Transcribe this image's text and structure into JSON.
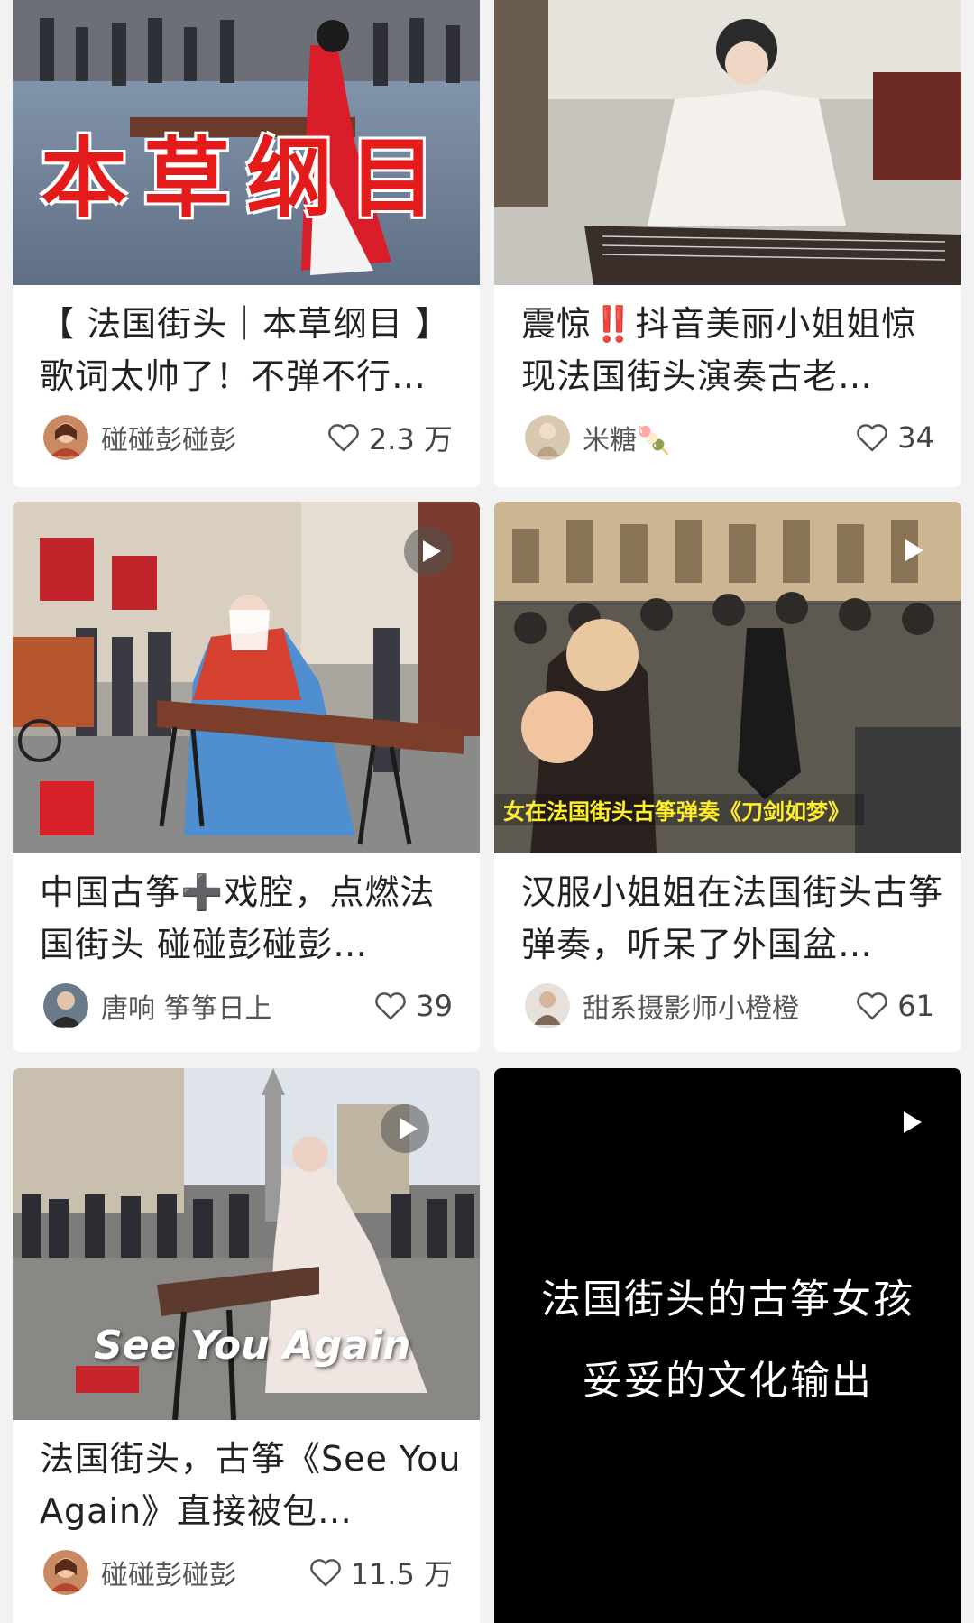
{
  "cards": [
    {
      "title": "【 法国街头｜本草纲目 】歌词太帅了！不弹不行…",
      "overlay_text": "本草纲目",
      "author": "碰碰彭碰彭",
      "likes": "2.3 万",
      "has_play": false
    },
    {
      "title_prefix": "震惊",
      "title_emoji": "‼️",
      "title_suffix": "抖音美丽小姐姐惊现法国街头演奏古老…",
      "author": "米糖🍡",
      "likes": "34",
      "has_play": false
    },
    {
      "title_prefix": "中国古筝",
      "title_emoji": "➕",
      "title_suffix": "戏腔，点燃法国街头 碰碰彭碰彭…",
      "author": "唐响 筝筝日上",
      "likes": "39",
      "has_play": true
    },
    {
      "title": "汉服小姐姐在法国街头古筝弹奏，听呆了外国盆…",
      "overlay_text": "女在法国街头古筝弹奏《刀剑如梦》",
      "author": "甜系摄影师小橙橙",
      "likes": "61",
      "has_play": true
    },
    {
      "title": "法国街头，古筝《See You Again》直接被包…",
      "overlay_text": "See You Again",
      "author": "碰碰彭碰彭",
      "likes": "11.5 万",
      "has_play": true
    },
    {
      "line1": "法国街头的古筝女孩",
      "line2": "妥妥的文化输出",
      "has_play": true
    }
  ],
  "colors": {
    "page_bg": "#f2f2f2",
    "card_bg": "#ffffff",
    "overlay_red": "#e31b1b",
    "caption_yellow": "#ffef2a"
  }
}
